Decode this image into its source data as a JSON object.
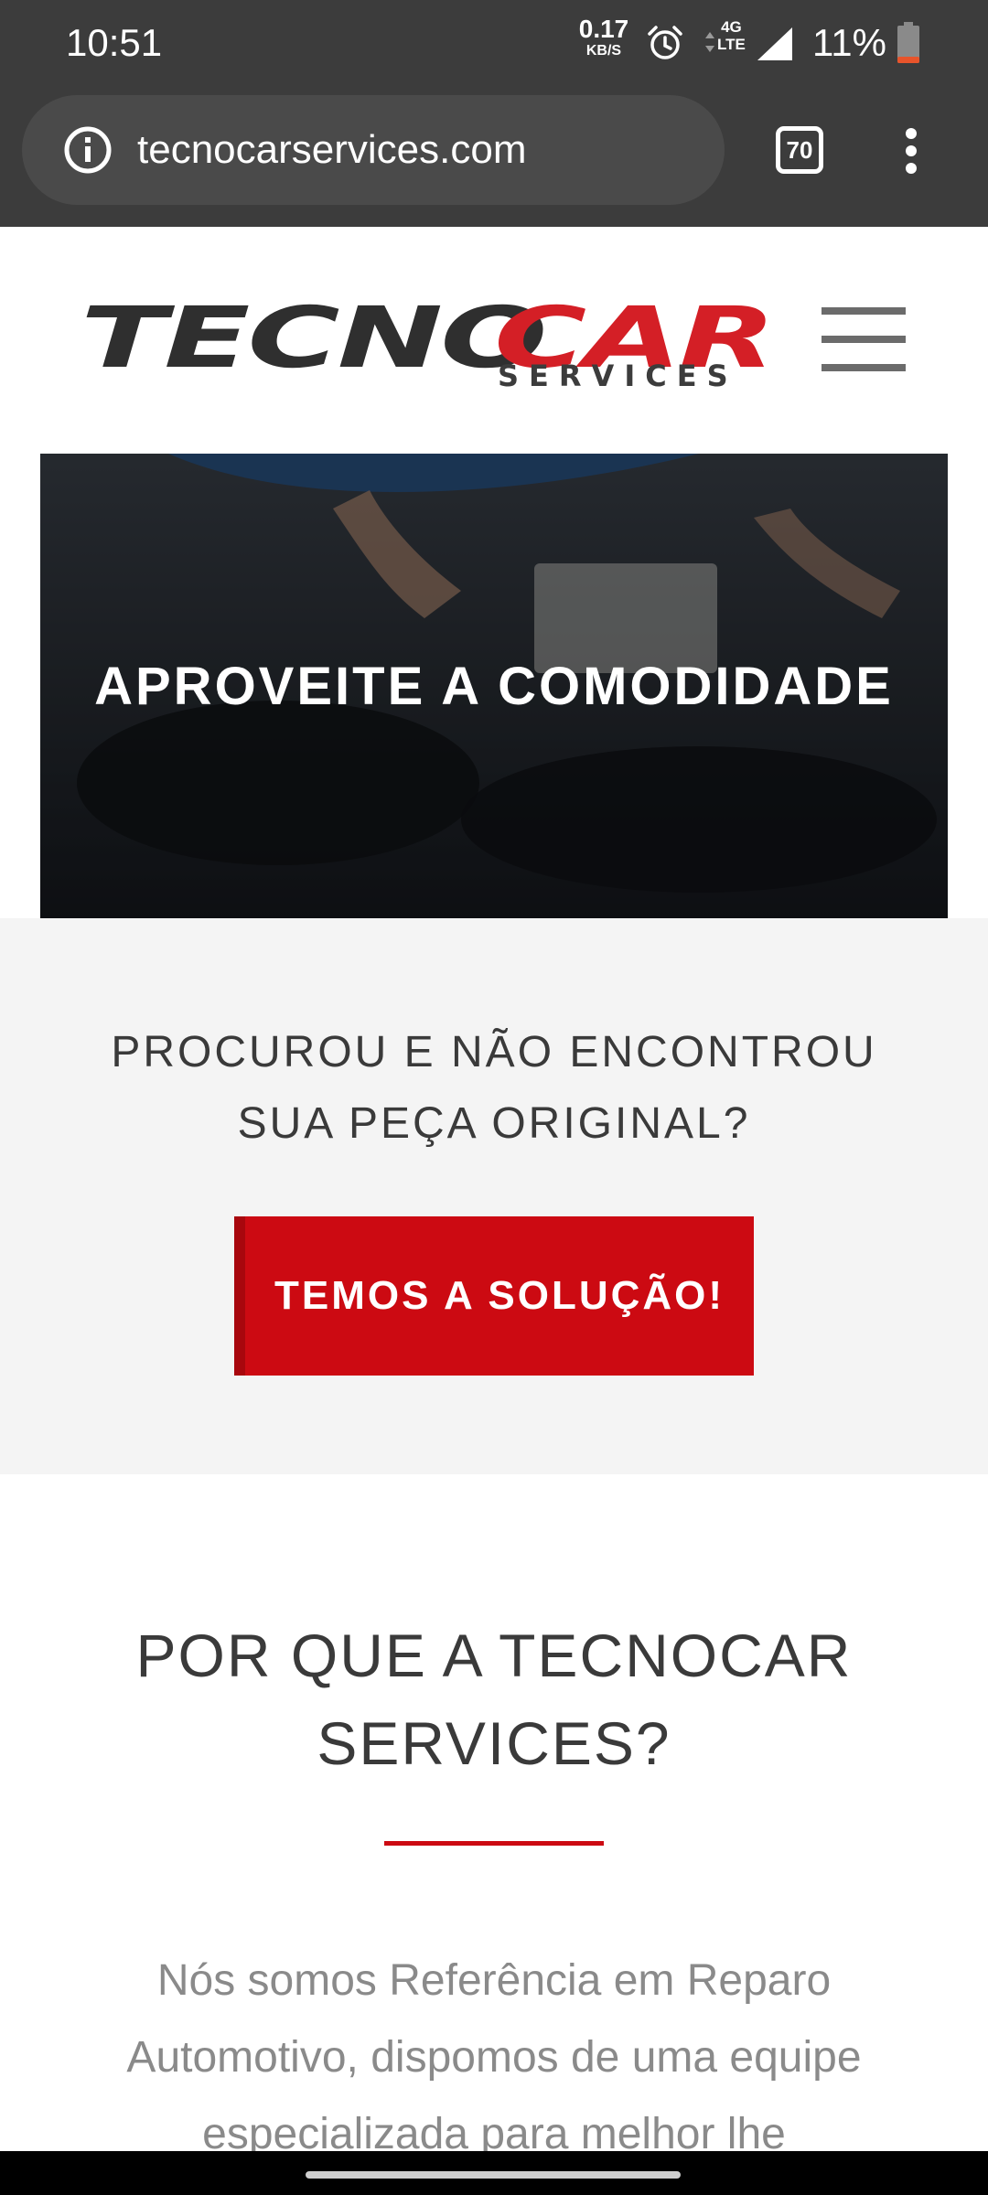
{
  "status_bar": {
    "time": "10:51",
    "net_speed_value": "0.17",
    "net_speed_unit": "KB/S",
    "network_type_top": "4G",
    "network_type_bottom": "LTE",
    "battery_percent": "11%",
    "icons": [
      "alarm-icon",
      "data-arrows-icon",
      "signal-icon",
      "battery-icon"
    ],
    "battery_color": "#e8542b"
  },
  "browser": {
    "url": "tecnocarservices.com",
    "tab_count": "70",
    "icons": [
      "info-icon",
      "tabs-icon",
      "more-vert-icon"
    ]
  },
  "header": {
    "logo_part1": "TECNO",
    "logo_part2": "CAR",
    "logo_sub": "SERVICES",
    "brand_red": "#d41f26",
    "menu_icon": "hamburger-menu-icon"
  },
  "hero": {
    "title": "APROVEITE A COMODIDADE"
  },
  "cta": {
    "question": "PROCUROU E NÃO ENCONTROU SUA PEÇA ORIGINAL?",
    "button_label": "TEMOS A SOLUÇÃO!",
    "button_color": "#cc0a12"
  },
  "why": {
    "title": "POR QUE A TECNOCAR SERVICES?",
    "text": "Nós somos Referência em Reparo Automotivo, dispomos de uma equipe especializada para melhor lhe"
  }
}
